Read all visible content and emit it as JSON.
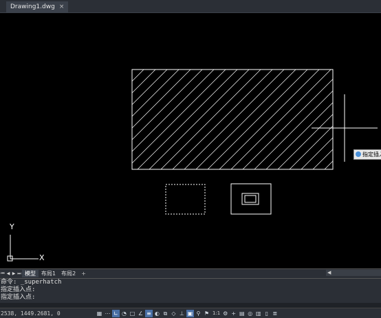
{
  "file_tab": {
    "title": "Drawing1.dwg",
    "close": "×"
  },
  "tooltip": {
    "text": "指定插入"
  },
  "layout_tabs": [
    "模型",
    "布局1",
    "布局2",
    "+"
  ],
  "command": {
    "lines": [
      "命令: _superhatch",
      "指定插入点:",
      "指定插入点:"
    ]
  },
  "status": {
    "coords": "2538, 1449.2681, 0",
    "scale": "1:1",
    "icons": [
      "grid-icon",
      "snap-icon",
      "ortho-icon",
      "polar-icon",
      "osnap-icon",
      "otrack-icon",
      "lineweight-icon",
      "transparency-icon",
      "selection-cycle-icon",
      "3dosnap-icon",
      "ucs-icon",
      "annotation-icon",
      "workspace-icon",
      "properties-icon",
      "isolate-icon",
      "hardware-icon",
      "cleanscreen-icon",
      "customize-icon"
    ]
  },
  "ucs": {
    "y_label": "Y",
    "x_label": "X"
  },
  "colors": {
    "background": "#000000",
    "lines": "#ffffff",
    "hatch": "#ffffff"
  }
}
